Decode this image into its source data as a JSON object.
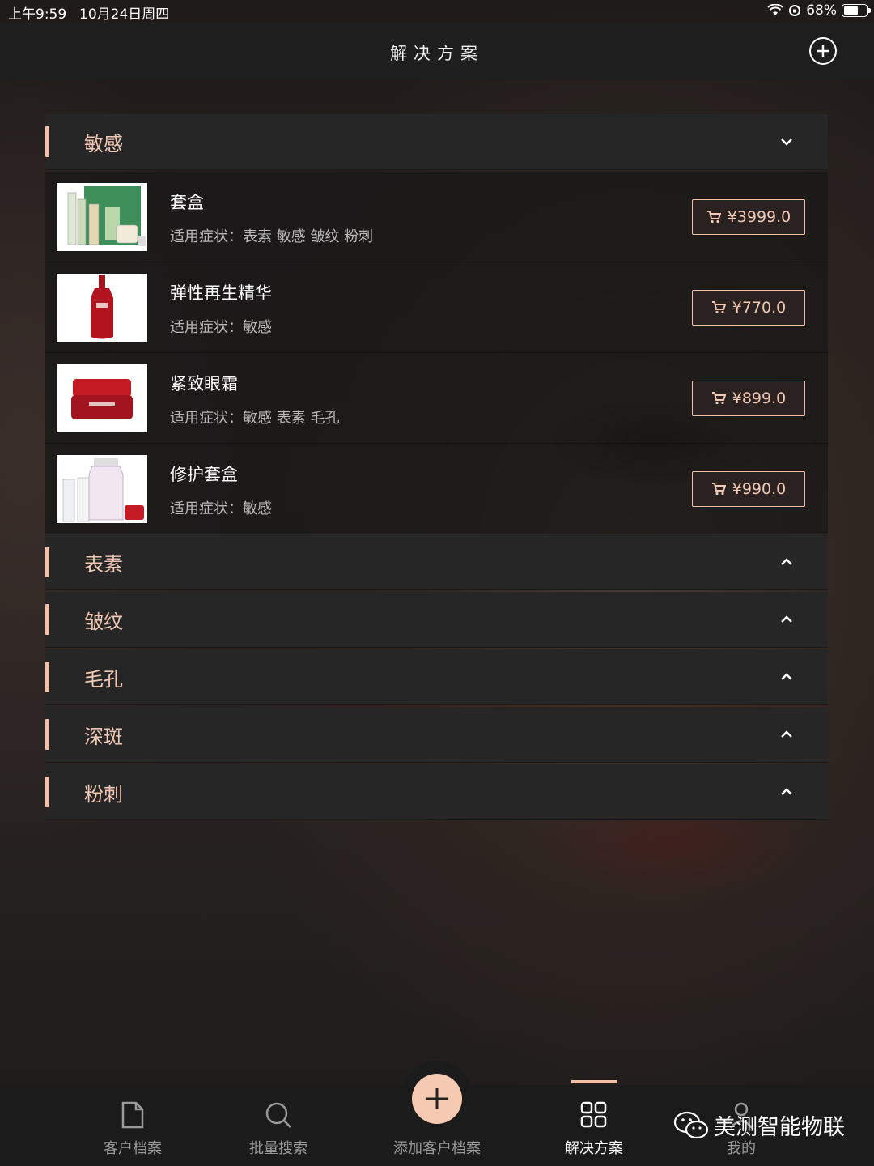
{
  "status_bar": {
    "time": "上午9:59",
    "date": "10月24日周四",
    "battery": "68%"
  },
  "header": {
    "title": "解决方案"
  },
  "categories": [
    {
      "name": "敏感",
      "expanded": true,
      "products": [
        {
          "name": "套盒",
          "symptoms": "适用症状：表素 敏感 皱纹 粉刺",
          "price": "¥3999.0"
        },
        {
          "name": "弹性再生精华",
          "symptoms": "适用症状：敏感",
          "price": "¥770.0"
        },
        {
          "name": "紧致眼霜",
          "symptoms": "适用症状：敏感 表素 毛孔",
          "price": "¥899.0"
        },
        {
          "name": "修护套盒",
          "symptoms": "适用症状：敏感",
          "price": "¥990.0"
        }
      ]
    },
    {
      "name": "表素",
      "expanded": false
    },
    {
      "name": "皱纹",
      "expanded": false
    },
    {
      "name": "毛孔",
      "expanded": false
    },
    {
      "name": "深斑",
      "expanded": false
    },
    {
      "name": "粉刺",
      "expanded": false
    }
  ],
  "tabbar": {
    "items": [
      {
        "label": "客户档案",
        "icon": "document-icon"
      },
      {
        "label": "批量搜索",
        "icon": "search-icon"
      },
      {
        "label": "添加客户档案",
        "icon": "plus-icon"
      },
      {
        "label": "解决方案",
        "icon": "grid-icon",
        "active": true
      },
      {
        "label": "我的",
        "icon": "profile-icon"
      }
    ]
  },
  "watermark": {
    "text": "美测智能物联"
  },
  "colors": {
    "accent": "#f2c0a8",
    "accent_text": "#f2c8b4",
    "fab": "#f6c9b3"
  }
}
